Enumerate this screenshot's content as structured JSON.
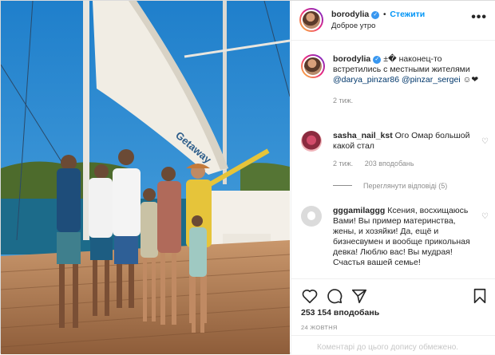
{
  "post": {
    "username": "borodylia",
    "follow_label": "Стежити",
    "separator": "•",
    "location": "Доброе утро",
    "more_label": "•••",
    "verified_icon": "verified-badge-icon"
  },
  "caption": {
    "username": "borodylia",
    "text": "±� наконец-то встретились с местными жителями",
    "mentions": [
      "@darya_pinzar86",
      "@pinzar_sergei"
    ],
    "emoji_tail": "☺❤",
    "time": "2 тиж."
  },
  "comments": [
    {
      "username": "sasha_nail_kst",
      "text": "Ого Омар большой какой стал",
      "time": "2 тиж.",
      "likes": "203 вподобань",
      "view_replies": "Переглянути відповіді (5)"
    },
    {
      "username": "gggamilaggg",
      "text": "Ксения, восхищаюсь Вами! Вы пример материнства, жены, и хозяйки! Да, ещё и бизнесвумен и вообще прикольная девка! Люблю вас! Вы мудрая! Счастья вашей семье!"
    }
  ],
  "actions": {
    "icons": [
      "heart-icon",
      "comment-icon",
      "share-icon",
      "bookmark-icon"
    ],
    "likes": "253 154 вподобань",
    "date": "24 жовтня",
    "comments_disabled": "Коментарі до цього допису обмежено."
  },
  "photo": {
    "boat_name": "Getaway",
    "colors": {
      "sky": "#2f8fd0",
      "sea": "#1c6b8a",
      "deck": "#b8835a",
      "sail": "#f1ede4"
    }
  }
}
